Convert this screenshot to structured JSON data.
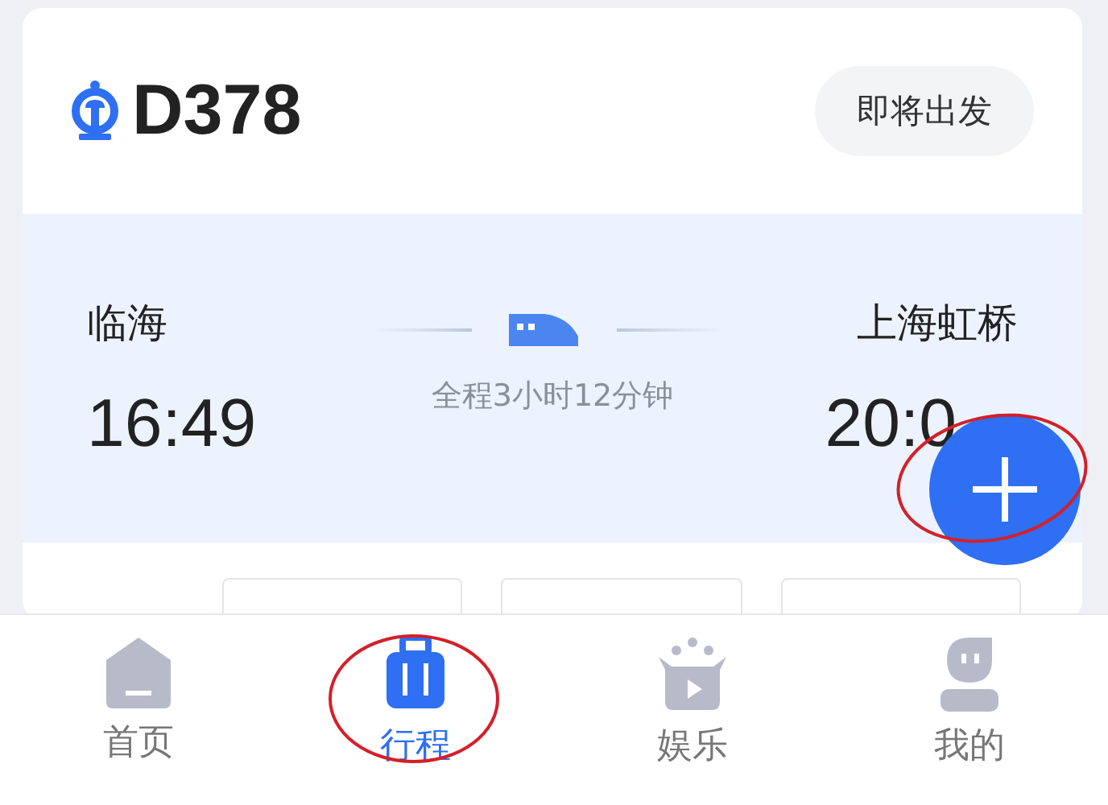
{
  "train": {
    "number": "D378",
    "status_button": "即将出发"
  },
  "route": {
    "from": {
      "station": "临海",
      "time": "16:49"
    },
    "duration": "全程3小时12分钟",
    "to": {
      "station": "上海虹桥",
      "time": "20:0"
    }
  },
  "fab": {
    "circled": true
  },
  "nav": [
    {
      "label": "首页",
      "kind": "home",
      "selected": false,
      "circled": false
    },
    {
      "label": "行程",
      "kind": "trip",
      "selected": true,
      "circled": true
    },
    {
      "label": "娱乐",
      "kind": "fun",
      "selected": false,
      "circled": false
    },
    {
      "label": "我的",
      "kind": "me",
      "selected": false,
      "circled": false
    }
  ]
}
